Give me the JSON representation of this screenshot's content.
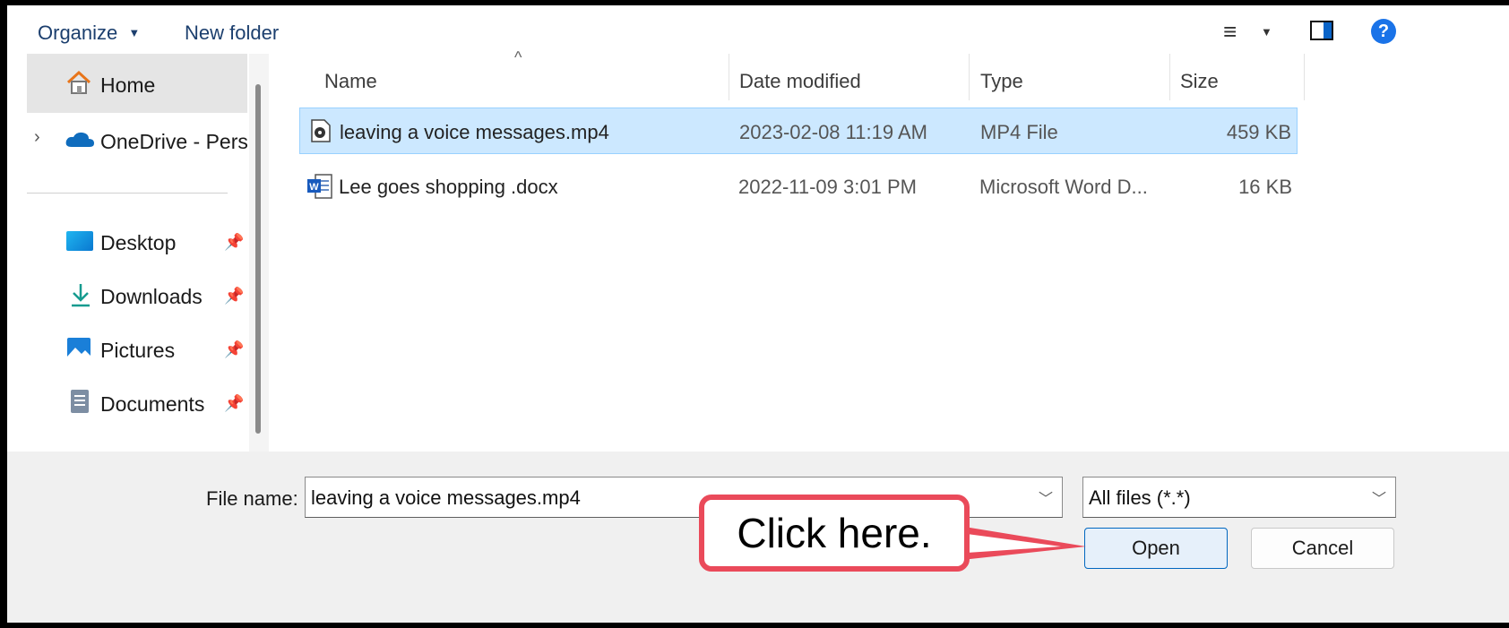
{
  "toolbar": {
    "organize_label": "Organize",
    "new_folder_label": "New folder"
  },
  "sidebar": {
    "home_label": "Home",
    "onedrive_label": "OneDrive - Perso",
    "desktop_label": "Desktop",
    "downloads_label": "Downloads",
    "pictures_label": "Pictures",
    "documents_label": "Documents"
  },
  "columns": {
    "name": "Name",
    "date": "Date modified",
    "type": "Type",
    "size": "Size"
  },
  "files": [
    {
      "name": "leaving a voice messages.mp4",
      "date": "2023-02-08 11:19 AM",
      "type": "MP4 File",
      "size": "459 KB",
      "selected": true
    },
    {
      "name": "Lee goes shopping .docx",
      "date": "2022-11-09 3:01 PM",
      "type": "Microsoft Word D...",
      "size": "16 KB",
      "selected": false
    }
  ],
  "bottom": {
    "file_name_label": "File name:",
    "file_name_value": "leaving a voice messages.mp4",
    "filter_value": "All files (*.*)",
    "open_label": "Open",
    "cancel_label": "Cancel"
  },
  "annotation": {
    "callout_text": "Click here."
  },
  "colors": {
    "selection": "#cce8ff",
    "accent": "#0067c0",
    "callout_border": "#ea4a5a"
  }
}
